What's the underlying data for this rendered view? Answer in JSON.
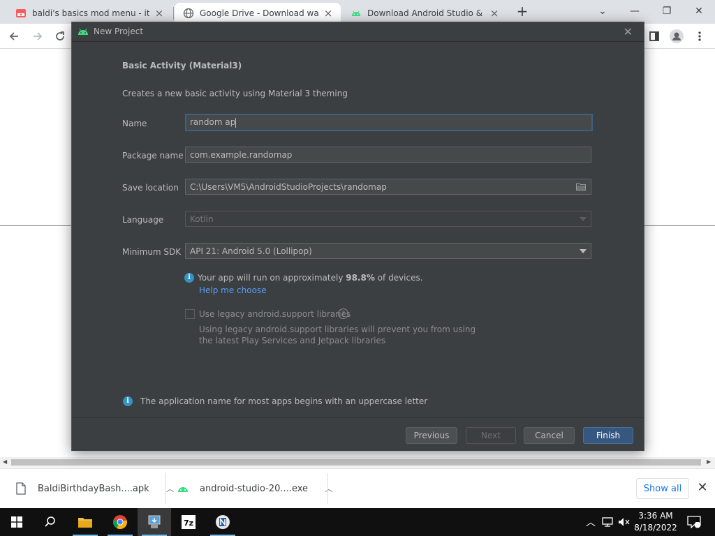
{
  "browser": {
    "tabs": [
      {
        "title": "baldi's basics mod menu - itch.io",
        "icon": "itchio-icon",
        "active": false
      },
      {
        "title": "Google Drive - Download warnin",
        "icon": "google-drive-icon",
        "active": true
      },
      {
        "title": "Download Android Studio & App",
        "icon": "android-icon",
        "active": false
      }
    ],
    "new_tab": "+",
    "window_controls": {
      "minimize": "—",
      "restore": "❐",
      "close": "✕",
      "tab_search": "⌄"
    }
  },
  "dialog": {
    "title": "New Project",
    "heading": "Basic Activity (Material3)",
    "description": "Creates a new basic activity using Material 3 theming",
    "fields": {
      "name": {
        "label": "Name",
        "value": "random ap"
      },
      "package": {
        "label": "Package name",
        "value": "com.example.randomap"
      },
      "save_location": {
        "label": "Save location",
        "value": "C:\\Users\\VM5\\AndroidStudioProjects\\randomap"
      },
      "language": {
        "label": "Language",
        "value": "Kotlin"
      },
      "min_sdk": {
        "label": "Minimum SDK",
        "value": "API 21: Android 5.0 (Lollipop)"
      }
    },
    "sdk_info": {
      "prefix": "Your app will run on approximately ",
      "percent": "98.8%",
      "suffix": " of devices."
    },
    "help_link": "Help me choose",
    "legacy_checkbox": {
      "label": "Use legacy android.support libraries",
      "checked": false
    },
    "legacy_desc_1": "Using legacy android.support libraries will prevent you from using",
    "legacy_desc_2": "the latest Play Services and Jetpack libraries",
    "hint": "The application name for most apps begins with an uppercase letter",
    "buttons": {
      "previous": "Previous",
      "next": "Next",
      "cancel": "Cancel",
      "finish": "Finish"
    }
  },
  "downloads": {
    "items": [
      {
        "name": "BaldiBirthdayBash....apk"
      },
      {
        "name": "android-studio-20....exe"
      }
    ],
    "show_all": "Show all"
  },
  "taskbar": {
    "time": "3:36 AM",
    "date": "8/18/2022",
    "notification_count": "1"
  },
  "colors": {
    "dialog_bg": "#3c3f41",
    "accent": "#365880",
    "link": "#589df6",
    "info": "#3592c4",
    "android_green": "#3ddc84"
  }
}
